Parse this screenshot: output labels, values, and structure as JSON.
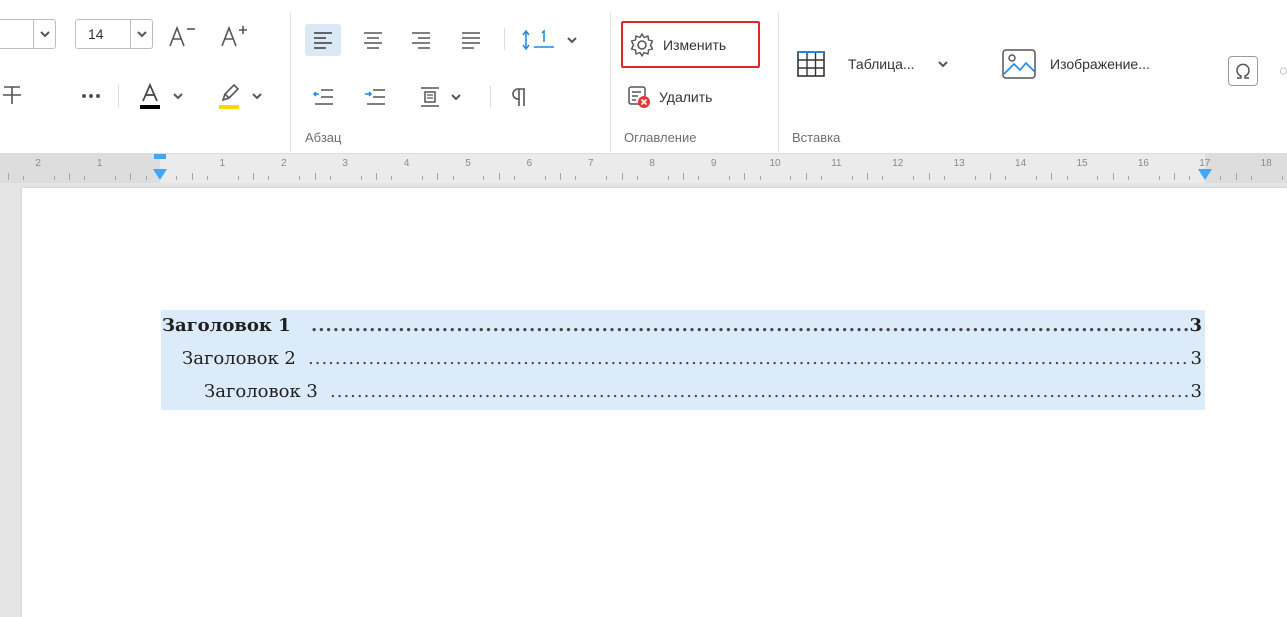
{
  "ribbon": {
    "font_size": "14",
    "paragraph_group_label": "Абзац",
    "toc_group_label": "Оглавление",
    "insert_group_label": "Вставка",
    "toc": {
      "edit_label": "Изменить",
      "delete_label": "Удалить"
    },
    "insert": {
      "table_label": "Таблица...",
      "image_label": "Изображение..."
    },
    "colors": {
      "font_color": "#000000",
      "highlight_color": "#ffd600",
      "accent": "#1e88e5",
      "edit_button_outline": "#e0262b"
    }
  },
  "ruler": {
    "numbers": [
      "2",
      "1",
      "1",
      "2",
      "3",
      "4",
      "5",
      "6",
      "7",
      "8",
      "9",
      "10",
      "11",
      "12",
      "13",
      "14",
      "15",
      "16",
      "17",
      "18"
    ]
  },
  "document": {
    "toc": [
      {
        "title": "Заголовок 1",
        "page": "3",
        "level": 1
      },
      {
        "title": "Заголовок 2",
        "page": "3",
        "level": 2
      },
      {
        "title": "Заголовок 3",
        "page": "3",
        "level": 3
      }
    ]
  }
}
